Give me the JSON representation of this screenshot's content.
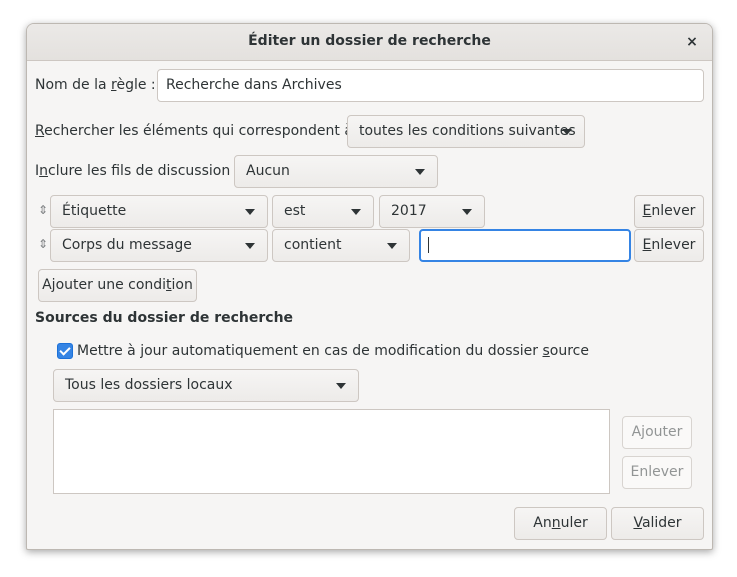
{
  "dialog": {
    "title": "Éditer un dossier de recherche",
    "close_glyph": "×"
  },
  "rule_name": {
    "label_pre": "Nom de la ",
    "label_u": "r",
    "label_post": "ègle :",
    "value": "Recherche dans Archives"
  },
  "match": {
    "label_u": "R",
    "label_post": "echercher les éléments qui correspondent à :",
    "selected": "toutes les conditions suivantes"
  },
  "threads": {
    "label_pre": "I",
    "label_u": "n",
    "label_post": "clure les fils de discussion :",
    "selected": "Aucun"
  },
  "conditions": [
    {
      "field": "Étiquette",
      "operator": "est",
      "value": "2017",
      "remove_u": "E",
      "remove_post": "nlever"
    },
    {
      "field": "Corps du message",
      "operator": "contient",
      "value": "",
      "remove_u": "E",
      "remove_post": "nlever"
    }
  ],
  "add_condition": {
    "label_pre": "Ajouter une condi",
    "label_u": "t",
    "label_post": "ion"
  },
  "sources": {
    "title": "Sources du dossier de recherche",
    "auto_update": {
      "checked": true,
      "label_pre": "Mettre à jour automatiquement en cas de modification du dossier ",
      "label_u": "s",
      "label_post": "ource"
    },
    "scope_selected": "Tous les dossiers locaux",
    "add_label": "Ajouter",
    "remove_label": "Enlever"
  },
  "footer": {
    "cancel_pre": "An",
    "cancel_u": "n",
    "cancel_post": "uler",
    "ok_u": "V",
    "ok_post": "alider"
  }
}
